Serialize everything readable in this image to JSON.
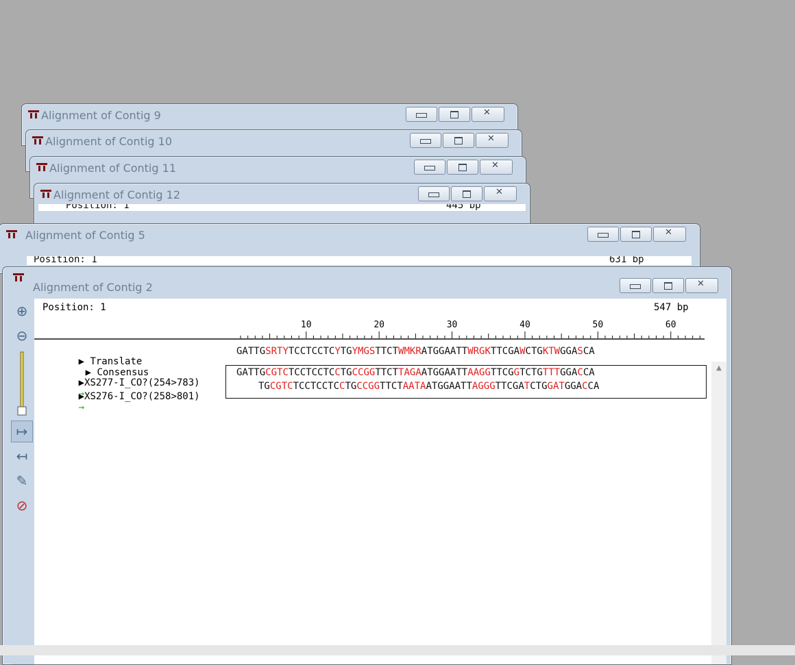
{
  "windows": [
    {
      "title": "Alignment of Contig 9"
    },
    {
      "title": "Alignment of Contig 10"
    },
    {
      "title": "Alignment of Contig 11"
    },
    {
      "title": "Alignment of Contig 12",
      "position": "Position: 1",
      "length": "445 bp"
    },
    {
      "title": "Alignment of Contig 5",
      "position": "Position: 1",
      "length": "631 bp"
    }
  ],
  "main": {
    "title": "Alignment of Contig 2",
    "position": "Position: 1",
    "length": "547 bp",
    "ruler_ticks": [
      "10",
      "20",
      "30",
      "40",
      "50",
      "60"
    ],
    "translate_label": "Translate",
    "consensus_label": "Consensus",
    "consensus_segments": [
      [
        "GATTG",
        "b"
      ],
      [
        "SRTY",
        "r"
      ],
      [
        "TCCTCCTC",
        "b"
      ],
      [
        "Y",
        "r"
      ],
      [
        "TG",
        "b"
      ],
      [
        "YMGS",
        "r"
      ],
      [
        "TTCT",
        "b"
      ],
      [
        "WMKR",
        "r"
      ],
      [
        "ATGGAATT",
        "b"
      ],
      [
        "WRGK",
        "r"
      ],
      [
        "TTCGA",
        "b"
      ],
      [
        "W",
        "r"
      ],
      [
        "CTG",
        "b"
      ],
      [
        "KTW",
        "r"
      ],
      [
        "GGA",
        "b"
      ],
      [
        "S",
        "r"
      ],
      [
        "CA",
        "b"
      ]
    ],
    "reads": [
      {
        "name": "XS277-I_CO?(254>783)",
        "segments": [
          [
            "GATTG",
            "b"
          ],
          [
            "CGTC",
            "r"
          ],
          [
            "TCCTCCTC",
            "b"
          ],
          [
            "C",
            "r"
          ],
          [
            "TG",
            "b"
          ],
          [
            "CCGG",
            "r"
          ],
          [
            "TTCT",
            "b"
          ],
          [
            "TAGA",
            "r"
          ],
          [
            "ATGGAATT",
            "b"
          ],
          [
            "AAGG",
            "r"
          ],
          [
            "TTCG",
            "b"
          ],
          [
            "G",
            "r"
          ],
          [
            "TCTG",
            "b"
          ],
          [
            "TTT",
            "r"
          ],
          [
            "GGA",
            "b"
          ],
          [
            "C",
            "r"
          ],
          [
            "CA",
            "b"
          ]
        ]
      },
      {
        "name": "XS276-I_CO?(258>801)",
        "segments": [
          [
            "TG",
            "b"
          ],
          [
            "CGTC",
            "r"
          ],
          [
            "TCCTCCTC",
            "b"
          ],
          [
            "C",
            "r"
          ],
          [
            "TG",
            "b"
          ],
          [
            "CCGG",
            "r"
          ],
          [
            "TTCT",
            "b"
          ],
          [
            "AATA",
            "r"
          ],
          [
            "ATGGAATT",
            "b"
          ],
          [
            "AGGG",
            "r"
          ],
          [
            "TTCGA",
            "b"
          ],
          [
            "T",
            "r"
          ],
          [
            "CTG",
            "b"
          ],
          [
            "GAT",
            "r"
          ],
          [
            "GGA",
            "b"
          ],
          [
            "C",
            "r"
          ],
          [
            "CA",
            "b"
          ]
        ]
      }
    ]
  },
  "colors": {
    "mismatch": "#e02020",
    "match": "#111111",
    "arrow": "#2aa02a"
  }
}
